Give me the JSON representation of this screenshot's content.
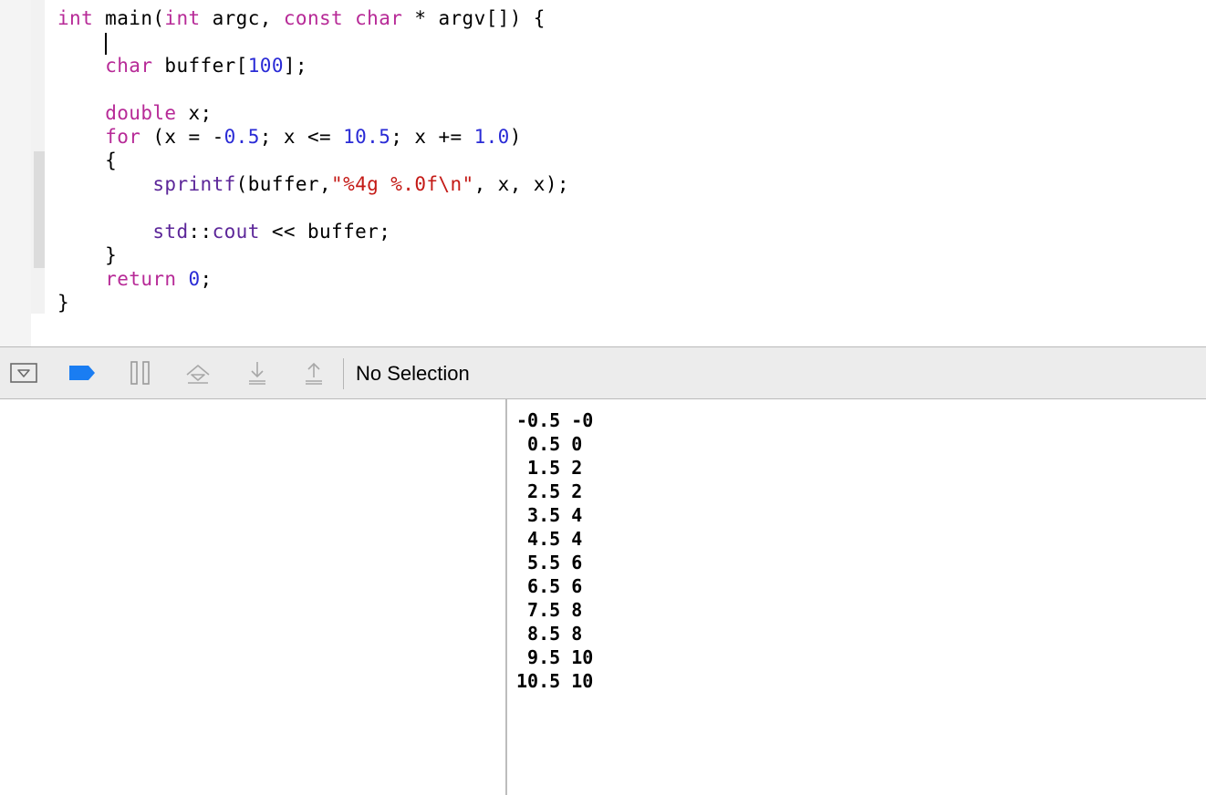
{
  "editor": {
    "lines": [
      [
        {
          "t": "int",
          "c": "kw"
        },
        {
          "t": " main(",
          "c": "pl"
        },
        {
          "t": "int",
          "c": "kw"
        },
        {
          "t": " argc, ",
          "c": "pl"
        },
        {
          "t": "const",
          "c": "kw"
        },
        {
          "t": " ",
          "c": "pl"
        },
        {
          "t": "char",
          "c": "kw"
        },
        {
          "t": " * argv[]) {",
          "c": "pl"
        }
      ],
      [],
      [
        {
          "t": "    ",
          "c": "pl"
        },
        {
          "t": "char",
          "c": "kw"
        },
        {
          "t": " buffer[",
          "c": "pl"
        },
        {
          "t": "100",
          "c": "num"
        },
        {
          "t": "];",
          "c": "pl"
        }
      ],
      [],
      [
        {
          "t": "    ",
          "c": "pl"
        },
        {
          "t": "double",
          "c": "kw"
        },
        {
          "t": " x;",
          "c": "pl"
        }
      ],
      [
        {
          "t": "    ",
          "c": "pl"
        },
        {
          "t": "for",
          "c": "kw"
        },
        {
          "t": " (x = -",
          "c": "pl"
        },
        {
          "t": "0.5",
          "c": "num"
        },
        {
          "t": "; x <= ",
          "c": "pl"
        },
        {
          "t": "10.5",
          "c": "num"
        },
        {
          "t": "; x += ",
          "c": "pl"
        },
        {
          "t": "1.0",
          "c": "num"
        },
        {
          "t": ")",
          "c": "pl"
        }
      ],
      [
        {
          "t": "    {",
          "c": "pl"
        }
      ],
      [
        {
          "t": "        ",
          "c": "pl"
        },
        {
          "t": "sprintf",
          "c": "fn"
        },
        {
          "t": "(buffer,",
          "c": "pl"
        },
        {
          "t": "\"%4g %.0f\\n\"",
          "c": "str"
        },
        {
          "t": ", x, x);",
          "c": "pl"
        }
      ],
      [],
      [
        {
          "t": "        ",
          "c": "pl"
        },
        {
          "t": "std",
          "c": "fn"
        },
        {
          "t": "::",
          "c": "pl"
        },
        {
          "t": "cout",
          "c": "fn"
        },
        {
          "t": " << buffer;",
          "c": "pl"
        }
      ],
      [
        {
          "t": "    }",
          "c": "pl"
        }
      ],
      [
        {
          "t": "    ",
          "c": "pl"
        },
        {
          "t": "return",
          "c": "kw"
        },
        {
          "t": " ",
          "c": "pl"
        },
        {
          "t": "0",
          "c": "num"
        },
        {
          "t": ";",
          "c": "pl"
        }
      ],
      [
        {
          "t": "}",
          "c": "pl"
        }
      ]
    ]
  },
  "debug_bar": {
    "buttons": [
      {
        "name": "toggle-console-button",
        "icon": "hide-debug-area-icon"
      },
      {
        "name": "breakpoints-button",
        "icon": "breakpoint-icon"
      },
      {
        "name": "pause-button",
        "icon": "pause-icon"
      },
      {
        "name": "step-over-button",
        "icon": "step-over-icon"
      },
      {
        "name": "step-into-button",
        "icon": "step-into-icon"
      },
      {
        "name": "step-out-button",
        "icon": "step-out-icon"
      }
    ],
    "breakpoint_color": "#1a7df2",
    "selection_label": "No Selection"
  },
  "console": {
    "output_lines": [
      "-0.5 -0",
      " 0.5 0",
      " 1.5 2",
      " 2.5 2",
      " 3.5 4",
      " 4.5 4",
      " 5.5 6",
      " 6.5 6",
      " 7.5 8",
      " 8.5 8",
      " 9.5 10",
      "10.5 10"
    ]
  }
}
